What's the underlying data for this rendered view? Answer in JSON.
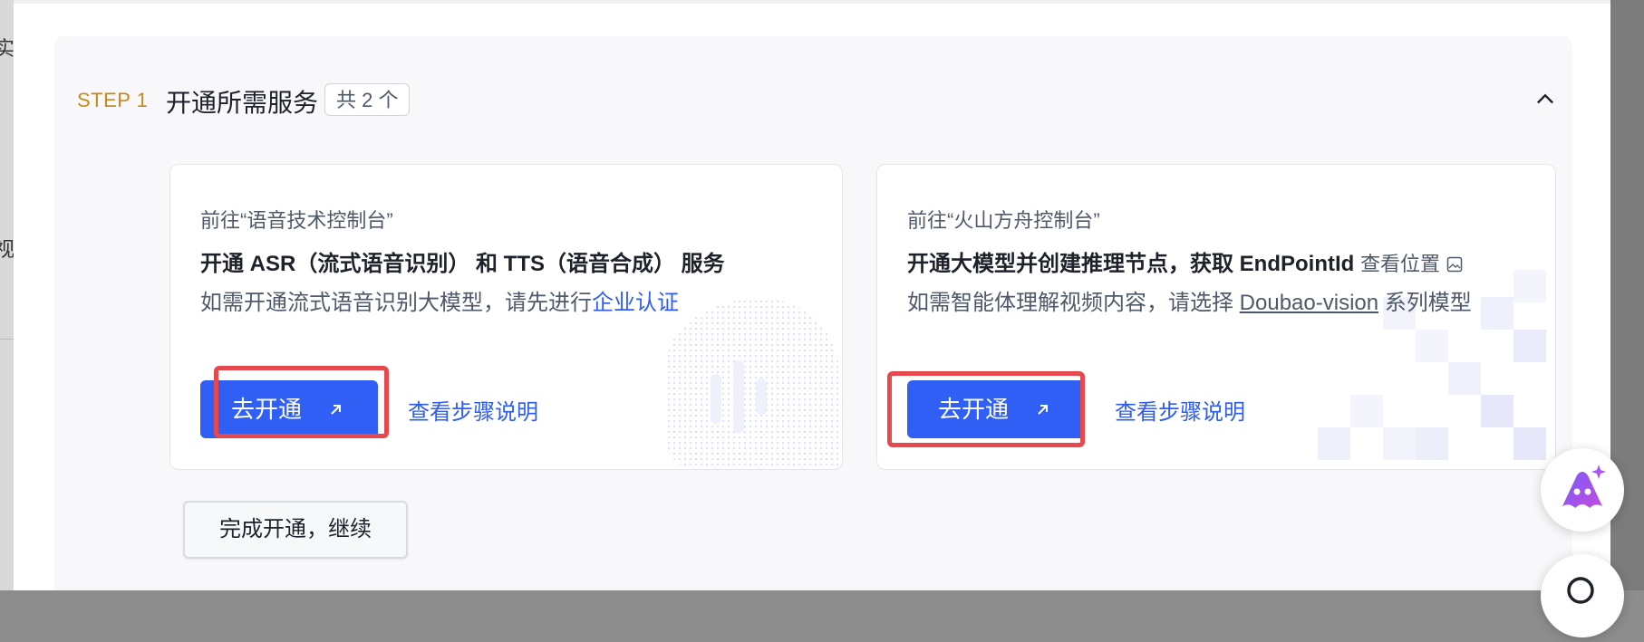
{
  "step": {
    "number": "STEP 1",
    "title": "开通所需服务",
    "count_badge": "共 2 个"
  },
  "cards": [
    {
      "pre": "前往“语音技术控制台”",
      "main": "开通 ASR（流式语音识别） 和 TTS（语音合成） 服务",
      "desc_text": "如需开通流式语音识别大模型，请先进行",
      "desc_link": "企业认证",
      "button_label": "去开通",
      "steps_link": "查看步骤说明"
    },
    {
      "pre": "前往“火山方舟控制台”",
      "main": "开通大模型并创建推理节点，获取 EndPointId",
      "main_suffix": "查看位置",
      "desc_text": "如需智能体理解视频内容，请选择",
      "desc_link": "Doubao-vision",
      "desc_tail": "系列模型",
      "button_label": "去开通",
      "steps_link": "查看步骤说明"
    }
  ],
  "continue_label": "完成开通，继续",
  "left_fragments": [
    "实",
    "视"
  ],
  "icons": [
    "chevron-up-icon",
    "external-arrow-icon",
    "image-icon",
    "assistant-icon",
    "search-icon"
  ],
  "colors": {
    "primary": "#2f5ff5",
    "step_accent": "#c48a1b",
    "highlight": "#e5484d"
  }
}
